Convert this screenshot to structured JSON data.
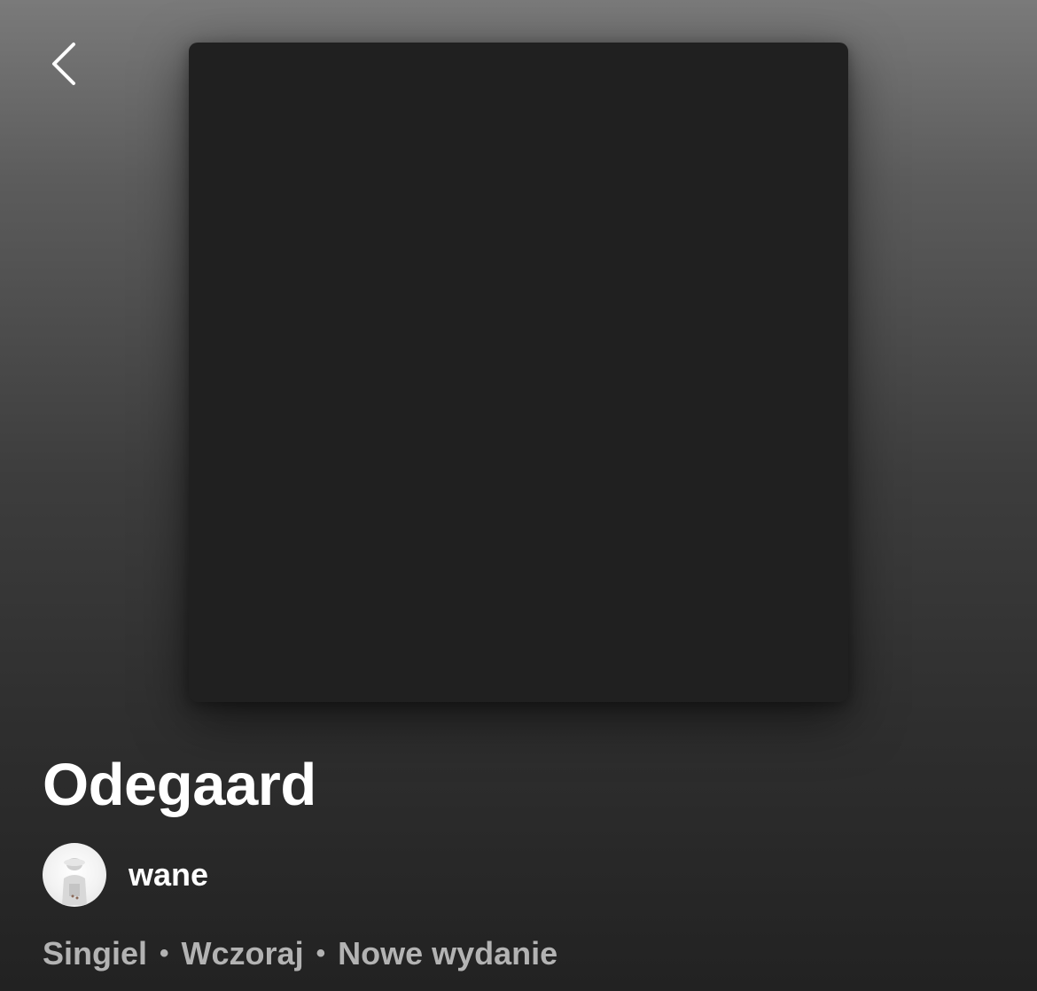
{
  "header": {
    "back_icon": "chevron-left-icon"
  },
  "album": {
    "title": "Odegaard",
    "artist": "wane",
    "type": "Singiel",
    "date": "Wczoraj",
    "badge": "Nowe wydanie",
    "separator": "•"
  },
  "colors": {
    "title": "#ffffff",
    "meta": "#b3b3b3",
    "cover": "#202020"
  }
}
